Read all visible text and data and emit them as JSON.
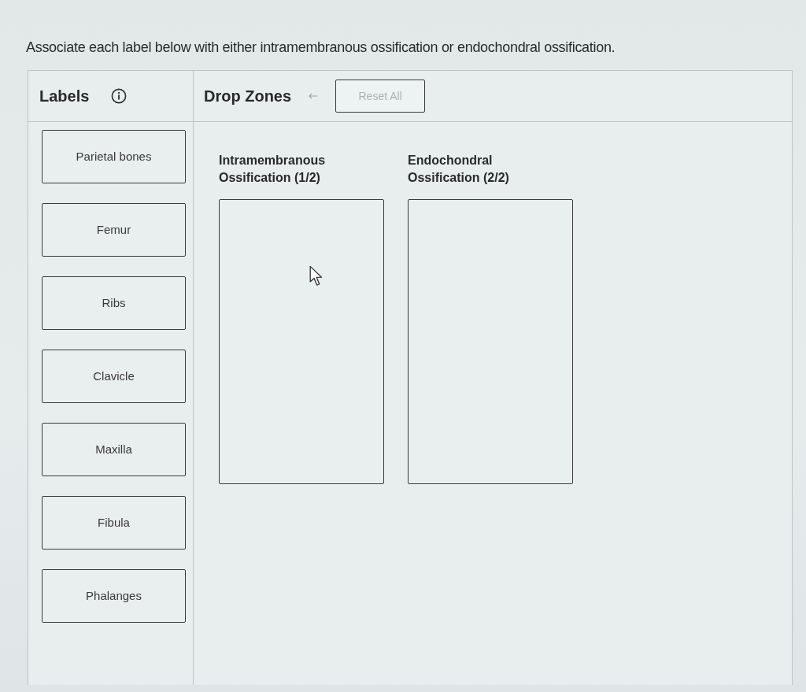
{
  "instruction": "Associate each label below with either intramembranous ossification or endochondral ossification.",
  "labels_panel": {
    "title": "Labels"
  },
  "drop_panel": {
    "title": "Drop Zones",
    "reset_button": {
      "label": "Reset All",
      "disabled": true
    }
  },
  "labels": [
    "Parietal bones",
    "Femur",
    "Ribs",
    "Clavicle",
    "Maxilla",
    "Fibula",
    "Phalanges"
  ],
  "drop_zones": [
    {
      "title": "Intramembranous Ossification (1/2)"
    },
    {
      "title": "Endochondral Ossification (2/2)"
    }
  ]
}
